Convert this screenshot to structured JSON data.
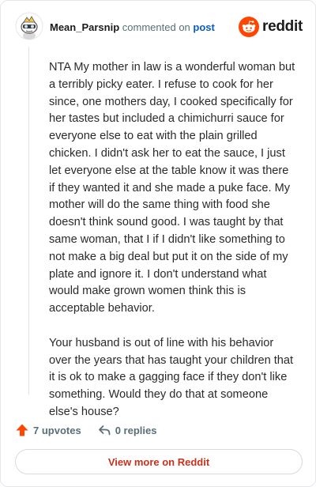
{
  "header": {
    "username": "Mean_Parsnip",
    "action_text": "commented on",
    "post_link": "post",
    "logo_text": "reddit"
  },
  "comment": {
    "paragraphs": [
      "NTA My mother in law is a wonderful woman but a terribly picky eater. I refuse to cook for her since, one mothers day, I cooked specifically for her tastes but included a chimichurri sauce for everyone else to eat with the plain grilled chicken. I didn't ask her to eat the sauce, I just let everyone else at the table know it was there if they wanted it and she made a puke face. My mother will do the same thing with food she doesn't think sound good. I was taught by that same woman, that I if I didn't like something to not make a big deal but put it on the side of my plate and ignore it. I don't understand what would make grown women think this is acceptable behavior.",
      "Your husband is out of line with his behavior over the years that has taught your children that it is ok to make a gagging face if they don't like something. Would they do that at someone else's house?"
    ]
  },
  "actions": {
    "upvotes_label": "7 upvotes",
    "replies_label": "0 replies"
  },
  "cta": {
    "label": "View more on Reddit"
  },
  "colors": {
    "reddit_orange": "#ff4500",
    "link_blue": "#0a5bc4",
    "cta_text": "#c8321d",
    "muted": "#576f76"
  },
  "icons": {
    "avatar": "snoo-avatar-icon",
    "logo": "reddit-logo-icon",
    "upvote": "upvote-arrow-icon",
    "reply": "reply-arrow-icon"
  }
}
